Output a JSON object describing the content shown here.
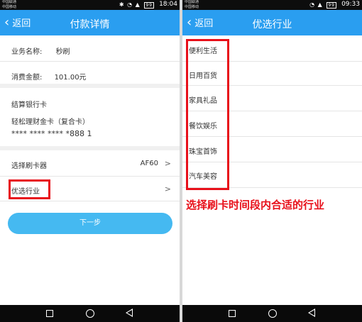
{
  "left": {
    "carrier": [
      "中国联通",
      "中国移动"
    ],
    "battery": "99",
    "time": "18:04",
    "back_label": "返回",
    "title": "付款详情",
    "business_name_label": "业务名称:",
    "business_name_value": "秒刷",
    "amount_label": "消费金额:",
    "amount_value": "101.00元",
    "bank_card_label": "结算银行卡",
    "bank_card_name": "轻松理财金卡（复合卡）",
    "bank_card_number": "**** **** **** *888 1",
    "select_reader_label": "选择刷卡器",
    "select_reader_value": "AF60",
    "preferred_industry_label": "优选行业",
    "next_button": "下一步"
  },
  "right": {
    "carrier": [
      "中国联通",
      "中国移动"
    ],
    "battery": "99",
    "time": "09:33",
    "back_label": "返回",
    "title": "优选行业",
    "industries": [
      "便利生活",
      "日用百货",
      "家具礼品",
      "餐饮娱乐",
      "珠宝首饰",
      "汽车美容"
    ]
  },
  "caption": "选择刷卡时间段内合适的行业",
  "colors": {
    "titlebar": "#2a9ef0",
    "button": "#45b9f1",
    "highlight": "#e8101a"
  }
}
